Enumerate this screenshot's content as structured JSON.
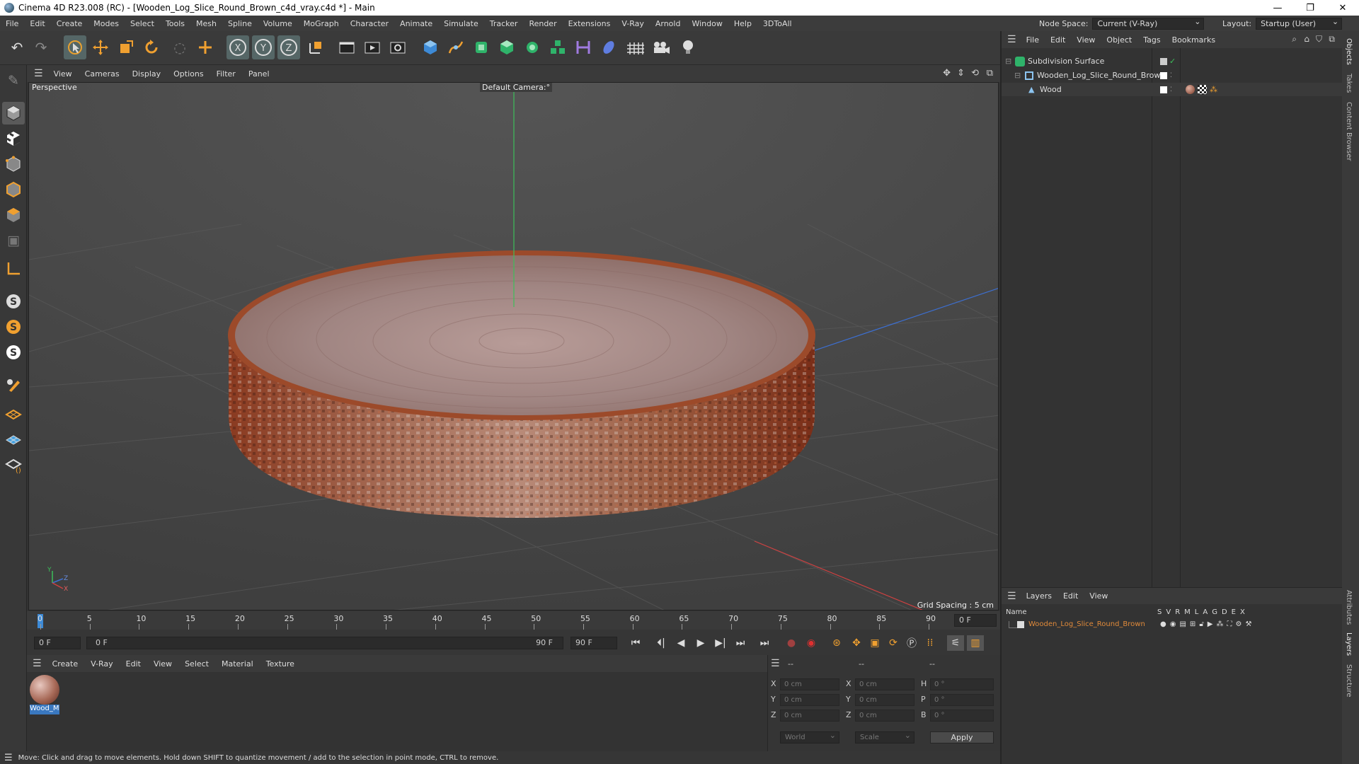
{
  "window": {
    "title": "Cinema 4D R23.008 (RC) - [Wooden_Log_Slice_Round_Brown_c4d_vray.c4d *] - Main",
    "minimize": "—",
    "maximize": "❐",
    "close": "✕"
  },
  "menubar": {
    "items": [
      "File",
      "Edit",
      "Create",
      "Modes",
      "Select",
      "Tools",
      "Mesh",
      "Spline",
      "Volume",
      "MoGraph",
      "Character",
      "Animate",
      "Simulate",
      "Tracker",
      "Render",
      "Extensions",
      "V-Ray",
      "Arnold",
      "Window",
      "Help",
      "3DToAll"
    ],
    "node_space_label": "Node Space:",
    "node_space_value": "Current (V-Ray)",
    "layout_label": "Layout:",
    "layout_value": "Startup (User)"
  },
  "toolbar": {
    "icons": [
      "undo-icon",
      "redo-icon",
      "select-cursor-icon",
      "move-icon",
      "scale-icon",
      "rotate-icon",
      "live-select-icon",
      "add-icon",
      "x-axis-icon",
      "y-axis-icon",
      "z-axis-icon",
      "coordinate-system-icon",
      "render-region-icon",
      "render-view-icon",
      "render-settings-icon",
      "cube-icon",
      "pen-spline-icon",
      "subdivision-icon",
      "extrude-icon",
      "array-icon",
      "mograph-cloner-icon",
      "deformer-icon",
      "field-icon",
      "floor-icon",
      "camera-icon",
      "light-icon"
    ]
  },
  "viewport": {
    "menu": [
      "View",
      "Cameras",
      "Display",
      "Options",
      "Filter",
      "Panel"
    ],
    "view_name": "Perspective",
    "camera": "Default Camera",
    "camera_suffix": ":°",
    "grid_spacing": "Grid Spacing : 5 cm",
    "axis_y": "Y",
    "axis_z": "Z",
    "axis_x": "X"
  },
  "timeline": {
    "ticks": [
      "0",
      "5",
      "10",
      "15",
      "20",
      "25",
      "30",
      "35",
      "40",
      "45",
      "50",
      "55",
      "60",
      "65",
      "70",
      "75",
      "80",
      "85",
      "90"
    ],
    "current_frame_right": "0 F",
    "start_frame": "0 F",
    "range_start": "0 F",
    "range_end": "90 F",
    "end_frame": "90 F"
  },
  "material_manager": {
    "menu": [
      "Create",
      "V-Ray",
      "Edit",
      "View",
      "Select",
      "Material",
      "Texture"
    ],
    "material_name": "Wood_M"
  },
  "coordinates": {
    "header": [
      "--",
      "--",
      "--"
    ],
    "rows": [
      {
        "a": "X",
        "av": "0 cm",
        "b": "X",
        "bv": "0 cm",
        "c": "H",
        "cv": "0 °"
      },
      {
        "a": "Y",
        "av": "0 cm",
        "b": "Y",
        "bv": "0 cm",
        "c": "P",
        "cv": "0 °"
      },
      {
        "a": "Z",
        "av": "0 cm",
        "b": "Z",
        "bv": "0 cm",
        "c": "B",
        "cv": "0 °"
      }
    ],
    "world": "World",
    "scale": "Scale",
    "apply": "Apply"
  },
  "status": "Move: Click and drag to move elements. Hold down SHIFT to quantize movement / add to the selection in point mode, CTRL to remove.",
  "object_manager": {
    "menu": [
      "File",
      "Edit",
      "View",
      "Object",
      "Tags",
      "Bookmarks"
    ],
    "objects": [
      {
        "name": "Subdivision Surface"
      },
      {
        "name": "Wooden_Log_Slice_Round_Brown"
      },
      {
        "name": "Wood"
      }
    ]
  },
  "layer_manager": {
    "menu": [
      "Layers",
      "Edit",
      "View"
    ],
    "col_name": "Name",
    "cols": [
      "S",
      "V",
      "R",
      "M",
      "L",
      "A",
      "G",
      "D",
      "E",
      "X"
    ],
    "layer": "Wooden_Log_Slice_Round_Brown"
  },
  "side_tabs": [
    "Objects",
    "Takes",
    "Content Browser",
    "Attributes",
    "Layers",
    "Structure"
  ],
  "colors": {
    "accent": "#f0a030",
    "layer_text": "#e08a3a",
    "viewport_bg": "#4a4a4a",
    "wood_top": "#a88a86",
    "wood_bark": "#a0492a"
  }
}
